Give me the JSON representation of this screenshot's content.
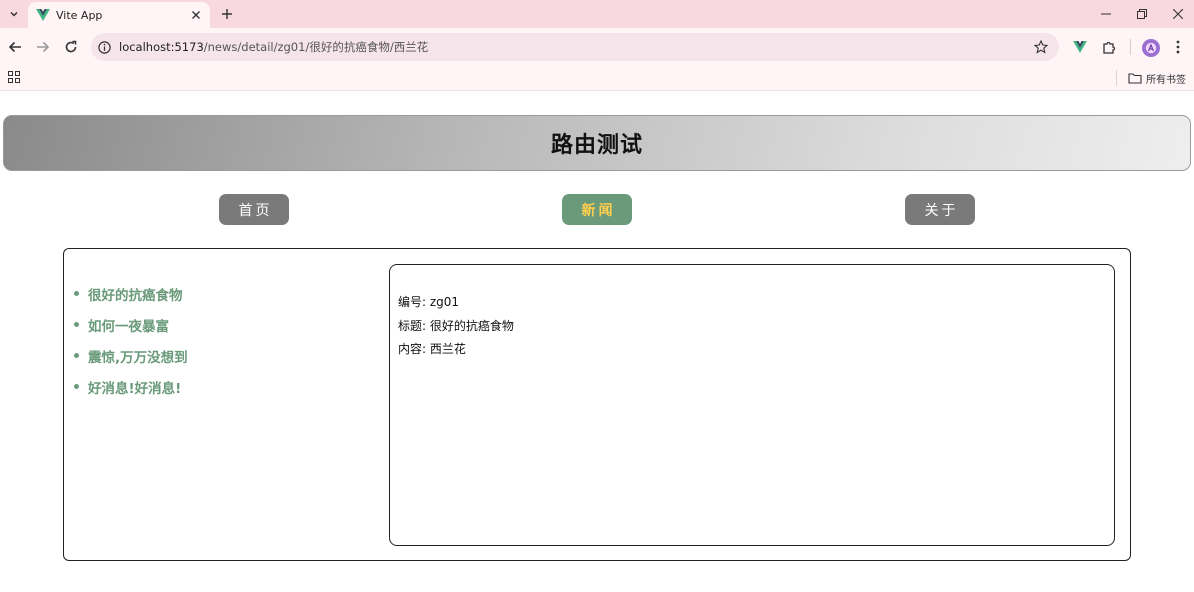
{
  "browser": {
    "tab_title": "Vite App",
    "url_host": "localhost:5173",
    "url_path": "/news/detail/zg01/很好的抗癌食物/西兰花",
    "bookmarks_label": "所有书签",
    "avatar_letter": "A"
  },
  "app": {
    "title": "路由测试",
    "nav": [
      {
        "label": "首页",
        "active": false
      },
      {
        "label": "新闻",
        "active": true
      },
      {
        "label": "关于",
        "active": false
      }
    ],
    "news_list": [
      "很好的抗癌食物",
      "如何一夜暴富",
      "震惊,万万没想到",
      "好消息!好消息!"
    ],
    "detail": {
      "id_label": "编号: zg01",
      "title_label": "标题: 很好的抗癌食物",
      "content_label": "内容: 西兰花"
    }
  },
  "colors": {
    "accent_green": "#6a9a7a",
    "active_text": "#ffcf4d",
    "nav_gray": "#7a7a7a",
    "chrome_pink": "#f9d9e0"
  },
  "icons": [
    "vue-logo-icon",
    "back-arrow-icon",
    "forward-arrow-icon",
    "reload-icon",
    "site-info-icon",
    "star-icon",
    "vue-devtools-icon",
    "extensions-icon",
    "kebab-menu-icon",
    "apps-grid-icon",
    "folder-icon"
  ]
}
